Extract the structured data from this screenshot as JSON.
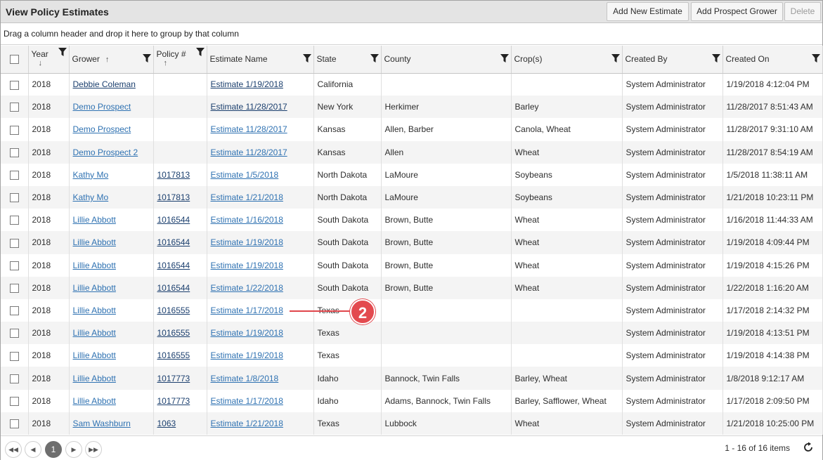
{
  "title": "View Policy Estimates",
  "toolbar": {
    "add_estimate": "Add New Estimate",
    "add_prospect": "Add Prospect Grower",
    "delete": "Delete"
  },
  "group_hint": "Drag a column header and drop it here to group by that column",
  "columns": {
    "year": "Year",
    "grower": "Grower",
    "policy": "Policy #",
    "estimate": "Estimate Name",
    "state": "State",
    "county": "County",
    "crops": "Crop(s)",
    "created_by": "Created By",
    "created_on": "Created On"
  },
  "rows": [
    {
      "year": "2018",
      "grower": "Debbie Coleman",
      "policy": "",
      "estimate": "Estimate 1/19/2018",
      "state": "California",
      "county": "",
      "crops": "",
      "created_by": "System Administrator",
      "created_on": "1/19/2018 4:12:04 PM"
    },
    {
      "year": "2018",
      "grower": "Demo Prospect",
      "policy": "",
      "estimate": "Estimate 11/28/2017",
      "state": "New York",
      "county": "Herkimer",
      "crops": "Barley",
      "created_by": "System Administrator",
      "created_on": "11/28/2017 8:51:43 AM"
    },
    {
      "year": "2018",
      "grower": "Demo Prospect",
      "policy": "",
      "estimate": "Estimate 11/28/2017",
      "state": "Kansas",
      "county": "Allen, Barber",
      "crops": "Canola, Wheat",
      "created_by": "System Administrator",
      "created_on": "11/28/2017 9:31:10 AM"
    },
    {
      "year": "2018",
      "grower": "Demo Prospect 2",
      "policy": "",
      "estimate": "Estimate 11/28/2017",
      "state": "Kansas",
      "county": "Allen",
      "crops": "Wheat",
      "created_by": "System Administrator",
      "created_on": "11/28/2017 8:54:19 AM"
    },
    {
      "year": "2018",
      "grower": "Kathy Mo",
      "policy": "1017813",
      "estimate": "Estimate 1/5/2018",
      "state": "North Dakota",
      "county": "LaMoure",
      "crops": "Soybeans",
      "created_by": "System Administrator",
      "created_on": "1/5/2018 11:38:11 AM"
    },
    {
      "year": "2018",
      "grower": "Kathy Mo",
      "policy": "1017813",
      "estimate": "Estimate 1/21/2018",
      "state": "North Dakota",
      "county": "LaMoure",
      "crops": "Soybeans",
      "created_by": "System Administrator",
      "created_on": "1/21/2018 10:23:11 PM"
    },
    {
      "year": "2018",
      "grower": "Lillie Abbott",
      "policy": "1016544",
      "estimate": "Estimate 1/16/2018",
      "state": "South Dakota",
      "county": "Brown, Butte",
      "crops": "Wheat",
      "created_by": "System Administrator",
      "created_on": "1/16/2018 11:44:33 AM"
    },
    {
      "year": "2018",
      "grower": "Lillie Abbott",
      "policy": "1016544",
      "estimate": "Estimate 1/19/2018",
      "state": "South Dakota",
      "county": "Brown, Butte",
      "crops": "Wheat",
      "created_by": "System Administrator",
      "created_on": "1/19/2018 4:09:44 PM"
    },
    {
      "year": "2018",
      "grower": "Lillie Abbott",
      "policy": "1016544",
      "estimate": "Estimate 1/19/2018",
      "state": "South Dakota",
      "county": "Brown, Butte",
      "crops": "Wheat",
      "created_by": "System Administrator",
      "created_on": "1/19/2018 4:15:26 PM"
    },
    {
      "year": "2018",
      "grower": "Lillie Abbott",
      "policy": "1016544",
      "estimate": "Estimate 1/22/2018",
      "state": "South Dakota",
      "county": "Brown, Butte",
      "crops": "Wheat",
      "created_by": "System Administrator",
      "created_on": "1/22/2018 1:16:20 AM"
    },
    {
      "year": "2018",
      "grower": "Lillie Abbott",
      "policy": "1016555",
      "estimate": "Estimate 1/17/2018",
      "state": "Texas",
      "county": "",
      "crops": "",
      "created_by": "System Administrator",
      "created_on": "1/17/2018 2:14:32 PM"
    },
    {
      "year": "2018",
      "grower": "Lillie Abbott",
      "policy": "1016555",
      "estimate": "Estimate 1/19/2018",
      "state": "Texas",
      "county": "",
      "crops": "",
      "created_by": "System Administrator",
      "created_on": "1/19/2018 4:13:51 PM"
    },
    {
      "year": "2018",
      "grower": "Lillie Abbott",
      "policy": "1016555",
      "estimate": "Estimate 1/19/2018",
      "state": "Texas",
      "county": "",
      "crops": "",
      "created_by": "System Administrator",
      "created_on": "1/19/2018 4:14:38 PM"
    },
    {
      "year": "2018",
      "grower": "Lillie Abbott",
      "policy": "1017773",
      "estimate": "Estimate 1/8/2018",
      "state": "Idaho",
      "county": "Bannock, Twin Falls",
      "crops": "Barley, Wheat",
      "created_by": "System Administrator",
      "created_on": "1/8/2018 9:12:17 AM"
    },
    {
      "year": "2018",
      "grower": "Lillie Abbott",
      "policy": "1017773",
      "estimate": "Estimate 1/17/2018",
      "state": "Idaho",
      "county": "Adams, Bannock, Twin Falls",
      "crops": "Barley, Safflower, Wheat",
      "created_by": "System Administrator",
      "created_on": "1/17/2018 2:09:50 PM"
    },
    {
      "year": "2018",
      "grower": "Sam Washburn",
      "policy": "1063",
      "estimate": "Estimate 1/21/2018",
      "state": "Texas",
      "county": "Lubbock",
      "crops": "Wheat",
      "created_by": "System Administrator",
      "created_on": "1/21/2018 10:25:00 PM"
    }
  ],
  "pager": {
    "current_page": "1",
    "info": "1 - 16 of 16 items"
  },
  "callout": {
    "number": "2",
    "color": "#e34a4f"
  }
}
